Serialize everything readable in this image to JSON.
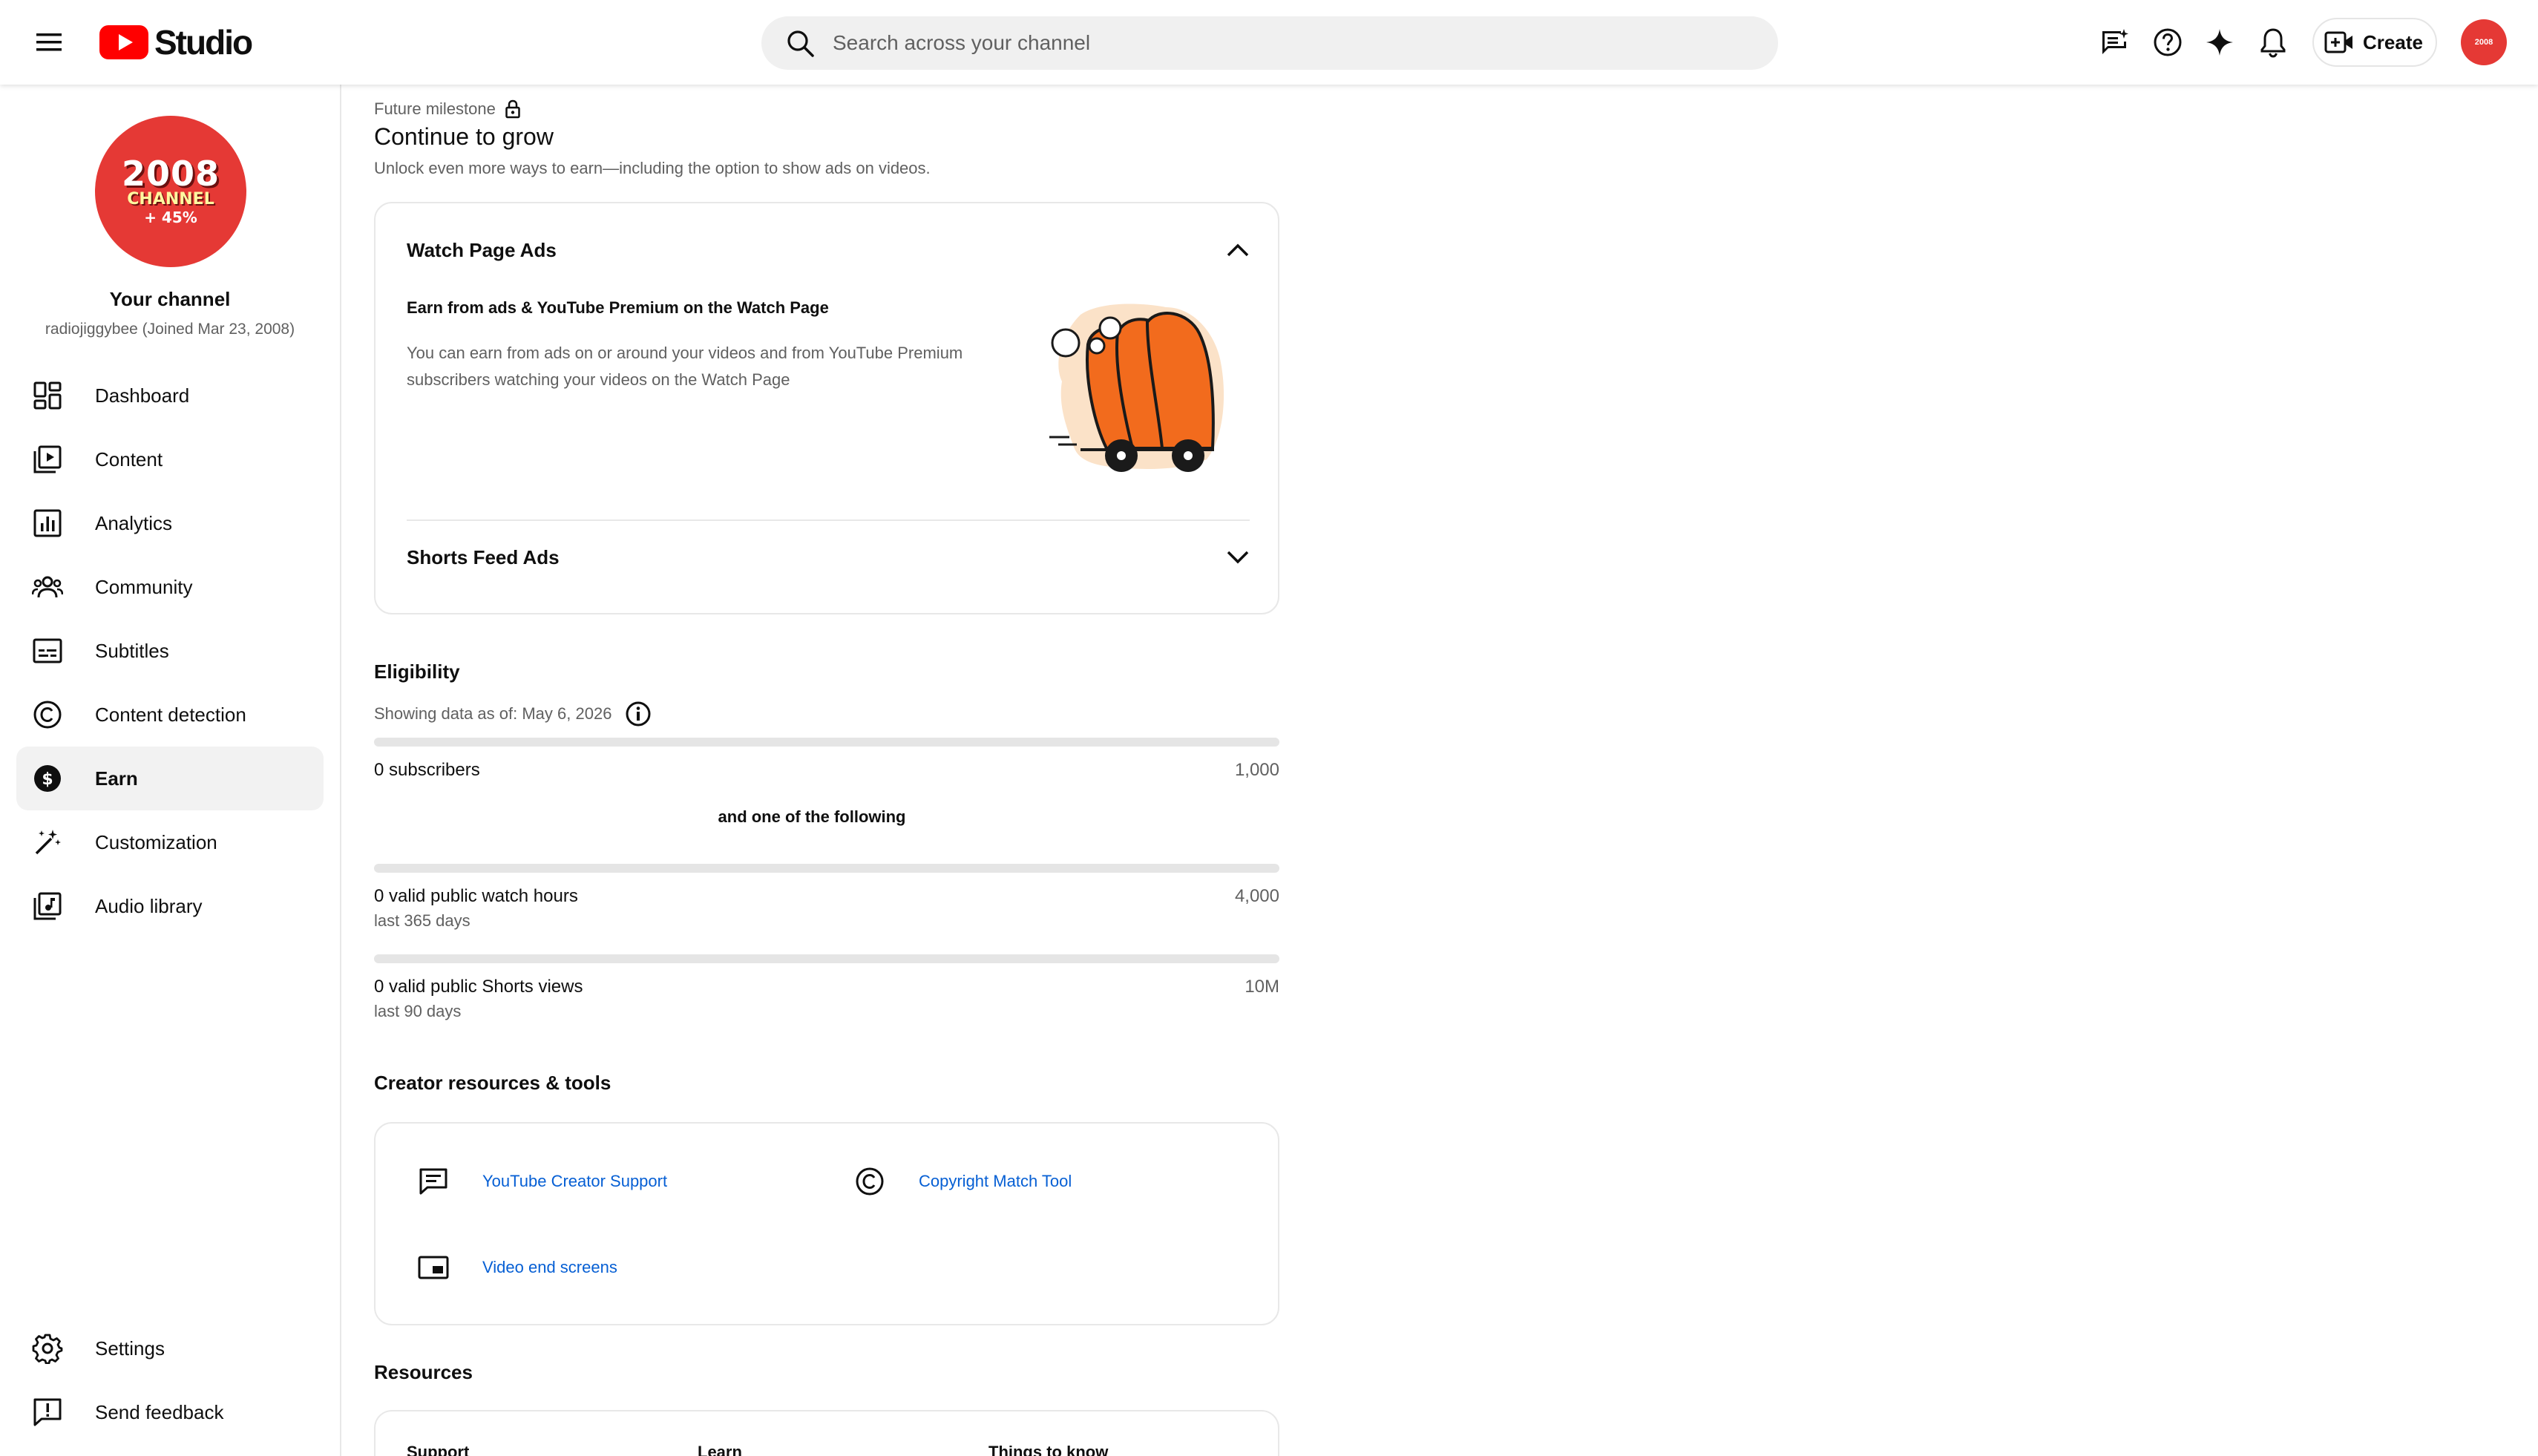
{
  "header": {
    "logo_text": "Studio",
    "search_placeholder": "Search across your channel",
    "create_label": "Create",
    "avatar_year": "2008"
  },
  "sidebar": {
    "avatar": {
      "year": "2008",
      "channel": "CHANNEL",
      "percent": "+ 45%"
    },
    "channel_title": "Your channel",
    "channel_sub": "radiojiggybee (Joined Mar 23, 2008)",
    "items": [
      {
        "label": "Dashboard",
        "icon": "dashboard-icon",
        "active": false
      },
      {
        "label": "Content",
        "icon": "content-icon",
        "active": false
      },
      {
        "label": "Analytics",
        "icon": "analytics-icon",
        "active": false
      },
      {
        "label": "Community",
        "icon": "community-icon",
        "active": false
      },
      {
        "label": "Subtitles",
        "icon": "subtitles-icon",
        "active": false
      },
      {
        "label": "Content detection",
        "icon": "copyright-icon",
        "active": false
      },
      {
        "label": "Earn",
        "icon": "dollar-icon",
        "active": true
      },
      {
        "label": "Customization",
        "icon": "magic-wand-icon",
        "active": false
      },
      {
        "label": "Audio library",
        "icon": "audio-library-icon",
        "active": false
      }
    ],
    "bottom_items": [
      {
        "label": "Settings",
        "icon": "gear-icon"
      },
      {
        "label": "Send feedback",
        "icon": "feedback-icon"
      }
    ]
  },
  "milestone": {
    "label": "Future milestone",
    "title": "Continue to grow",
    "description": "Unlock even more ways to earn—including the option to show ads on videos."
  },
  "ads": {
    "watch_page": {
      "title": "Watch Page Ads",
      "body_title": "Earn from ads & YouTube Premium on the Watch Page",
      "body_text": "You can earn from ads on or around your videos and from YouTube Premium subscribers watching your videos on the Watch Page"
    },
    "shorts_feed": {
      "title": "Shorts Feed Ads"
    }
  },
  "eligibility": {
    "title": "Eligibility",
    "date_text": "Showing data as of: May 6, 2026",
    "and_one": "and one of the following",
    "requirements": [
      {
        "label": "0 subscribers",
        "sub": "",
        "target": "1,000",
        "progress": 0
      },
      {
        "label": "0 valid public watch hours",
        "sub": "last 365 days",
        "target": "4,000",
        "progress": 0
      },
      {
        "label": "0 valid public Shorts views",
        "sub": "last 90 days",
        "target": "10M",
        "progress": 0
      }
    ]
  },
  "tools": {
    "title": "Creator resources & tools",
    "links": [
      {
        "label": "YouTube Creator Support",
        "icon": "chat-support-icon"
      },
      {
        "label": "Copyright Match Tool",
        "icon": "copyright-icon"
      },
      {
        "label": "Video end screens",
        "icon": "end-screen-icon"
      }
    ]
  },
  "resources": {
    "title": "Resources",
    "columns": [
      "Support",
      "Learn",
      "Things to know"
    ]
  },
  "colors": {
    "accent": "#065fd4",
    "brand_red": "#ff0000",
    "avatar_red": "#e53935"
  }
}
